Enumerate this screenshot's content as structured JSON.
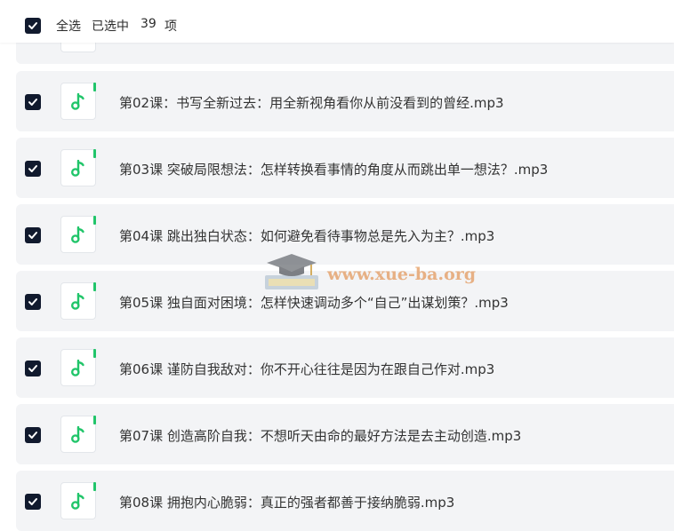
{
  "header": {
    "select_all_label": "全选",
    "selected_prefix": "已选中",
    "selected_count": "39",
    "selected_suffix": "项"
  },
  "files": [
    {
      "name": "第02课：书写全新过去：用全新视角看你从前没看到的曾经.mp3",
      "checked": true
    },
    {
      "name": "第03课 突破局限想法：怎样转换看事情的角度从而跳出单一想法？.mp3",
      "checked": true
    },
    {
      "name": "第04课 跳出独白状态：如何避免看待事物总是先入为主？.mp3",
      "checked": true
    },
    {
      "name": "第05课 独自面对困境：怎样快速调动多个“自己”出谋划策？.mp3",
      "checked": true
    },
    {
      "name": "第06课 谨防自我敌对：你不开心往往是因为在跟自己作对.mp3",
      "checked": true
    },
    {
      "name": "第07课 创造高阶自我：不想听天由命的最好方法是去主动创造.mp3",
      "checked": true
    },
    {
      "name": "第08课 拥抱内心脆弱：真正的强者都善于接纳脆弱.mp3",
      "checked": true
    }
  ],
  "icons": {
    "checkbox": "checkbox-checked-icon",
    "file": "audio-file-icon"
  },
  "colors": {
    "checkbox": "#111a2e",
    "accent": "#21c56a",
    "row_background": "#f3f4f6"
  },
  "watermark": {
    "text": "www.xue-ba.org"
  }
}
